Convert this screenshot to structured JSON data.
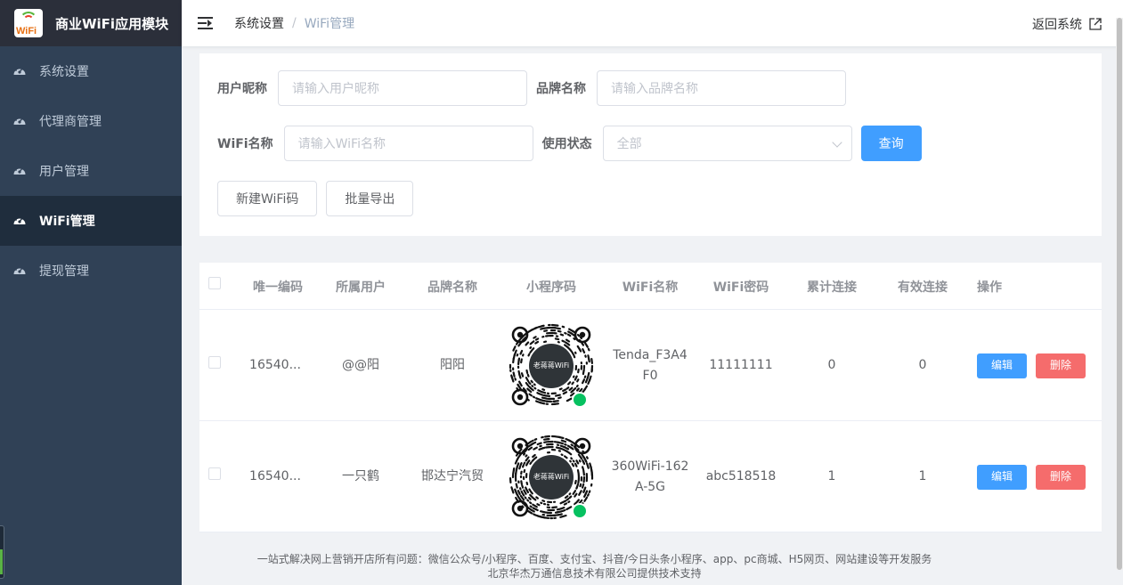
{
  "app": {
    "title": "商业WiFi应用模块",
    "logo_text": "WiFi"
  },
  "sidebar": {
    "items": [
      {
        "label": "系统设置",
        "icon": "speedometer-icon",
        "active": false
      },
      {
        "label": "代理商管理",
        "icon": "speedometer-icon",
        "active": false
      },
      {
        "label": "用户管理",
        "icon": "speedometer-icon",
        "active": false
      },
      {
        "label": "WiFi管理",
        "icon": "speedometer-icon",
        "active": true
      },
      {
        "label": "提现管理",
        "icon": "speedometer-icon",
        "active": false
      }
    ]
  },
  "header": {
    "breadcrumb": [
      "系统设置",
      "WiFi管理"
    ],
    "return_label": "返回系统"
  },
  "search": {
    "user_nick": {
      "label": "用户昵称",
      "placeholder": "请输入用户昵称"
    },
    "brand_name": {
      "label": "品牌名称",
      "placeholder": "请输入品牌名称"
    },
    "wifi_name": {
      "label": "WiFi名称",
      "placeholder": "请输入WiFi名称"
    },
    "status": {
      "label": "使用状态",
      "selected": "全部"
    },
    "query_label": "查询",
    "new_label": "新建WiFi码",
    "export_label": "批量导出"
  },
  "table": {
    "headers": [
      "唯一编码",
      "所属用户",
      "品牌名称",
      "小程序码",
      "WiFi名称",
      "WiFi密码",
      "累计连接",
      "有效连接",
      "操作"
    ],
    "rows": [
      {
        "code": "16540...",
        "user": "@@阳",
        "brand": "阳阳",
        "qr_text": "老蒋蒋WiFi",
        "wifi_name": "Tenda_F3A4F0",
        "wifi_name_l1": "Tenda_F3A4",
        "wifi_name_l2": "F0",
        "password": "11111111",
        "total": "0",
        "valid": "0"
      },
      {
        "code": "16540...",
        "user": "一只鹤",
        "brand": "邯达宁汽贸",
        "qr_text": "老蒋蒋WiFi",
        "wifi_name": "360WiFi-162A-5G",
        "wifi_name_l1": "360WiFi-162",
        "wifi_name_l2": "A-5G",
        "password": "abc518518",
        "total": "1",
        "valid": "1"
      }
    ],
    "edit_label": "编辑",
    "delete_label": "删除"
  },
  "footer": {
    "line1": "一站式解决网上营销开店所有问题：微信公众号/小程序、百度、支付宝、抖音/今日头条小程序、app、pc商城、H5网页、网站建设等开发服务",
    "line2": "北京华杰万通信息技术有限公司提供技术支持"
  },
  "colors": {
    "sidebar_bg": "#304156",
    "primary": "#409eff",
    "danger": "#f56c6c"
  }
}
